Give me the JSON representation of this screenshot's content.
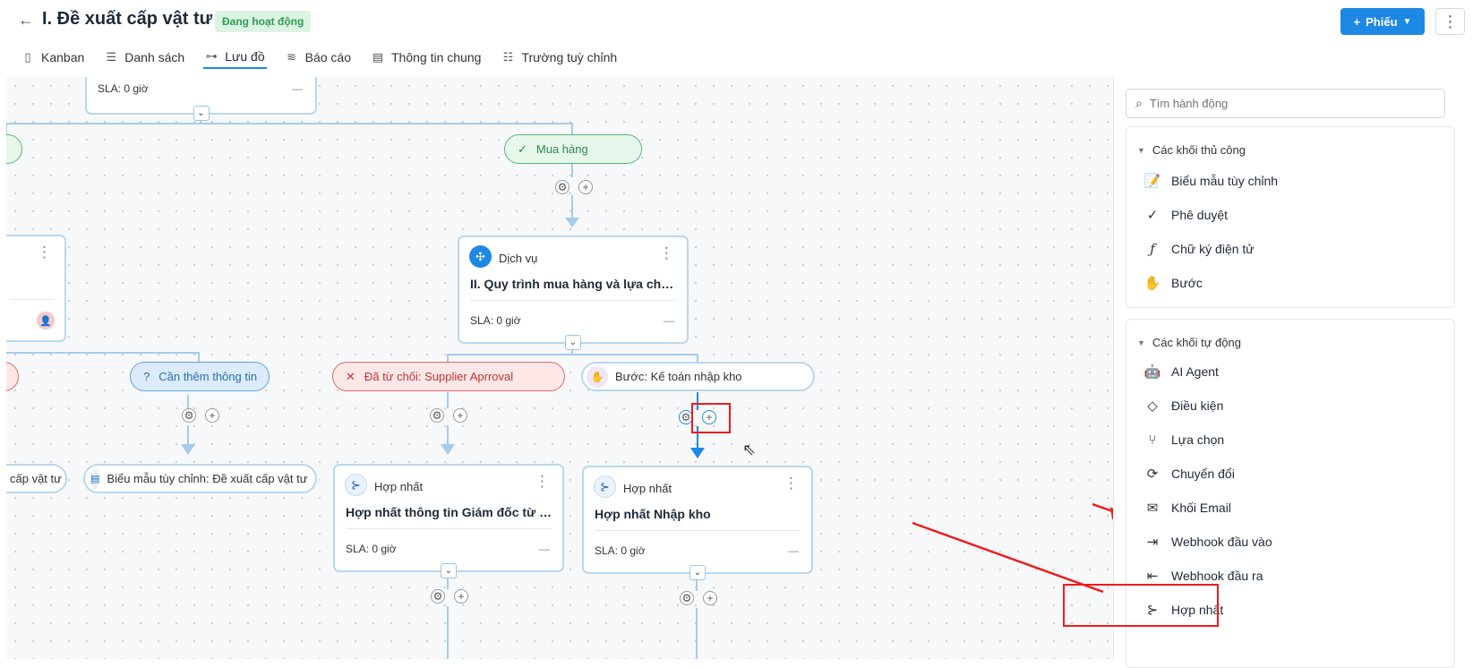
{
  "header": {
    "back_icon": "arrow-left-icon",
    "title": "I. Đề xuất cấp vật tư",
    "status": "Đang hoạt động",
    "ticket_button": "Phiếu",
    "more_icon": "kebab-vertical-icon"
  },
  "tabs": [
    {
      "label": "Kanban",
      "icon": "kanban-icon"
    },
    {
      "label": "Danh sách",
      "icon": "list-icon"
    },
    {
      "label": "Lưu đồ",
      "icon": "flowchart-icon",
      "active": true
    },
    {
      "label": "Báo cáo",
      "icon": "report-icon"
    },
    {
      "label": "Thông tin chung",
      "icon": "info-icon"
    },
    {
      "label": "Trường tuỳ chỉnh",
      "icon": "custom-fields-icon"
    }
  ],
  "flow": {
    "top_node": {
      "sla_label": "SLA:",
      "sla_value": "0 giờ",
      "dash": "—"
    },
    "pill_mua_hang": "Mua hàng",
    "dich_vu_node": {
      "type": "Dịch vụ",
      "name": "II. Quy trình mua hàng và lựa chọn ...",
      "sla_label": "SLA:",
      "sla_value": "0 giờ",
      "dash": "—"
    },
    "pill_can_them": "Cần thêm thông tin",
    "pill_da_tu_choi": "Đã từ chối: Supplier Aprroval",
    "pill_buoc": "Bước: Kế toán nhập kho",
    "left_partial_pill": "cấp vật tư",
    "pill_bieu_mau": "Biểu mẫu tùy chỉnh: Đề xuất cấp vật tư",
    "hop_nhat_1": {
      "type": "Hợp nhất",
      "name": "Hợp nhất thông tin Giám đốc từ ch...",
      "sla_label": "SLA:",
      "sla_value": "0 giờ",
      "dash": "—"
    },
    "hop_nhat_2": {
      "type": "Hợp nhất",
      "name": "Hợp nhất Nhập kho",
      "sla_label": "SLA:",
      "sla_value": "0 giờ",
      "dash": "—"
    }
  },
  "sidebar": {
    "search_placeholder": "Tìm hành động",
    "manual_group": {
      "title": "Các khối thủ công",
      "items": [
        {
          "label": "Biểu mẫu tùy chỉnh",
          "icon": "form-icon"
        },
        {
          "label": "Phê duyệt",
          "icon": "check-circle-icon"
        },
        {
          "label": "Chữ ký điện tử",
          "icon": "signature-icon"
        },
        {
          "label": "Bước",
          "icon": "step-icon"
        }
      ]
    },
    "auto_group": {
      "title": "Các khối tự động",
      "items": [
        {
          "label": "AI Agent",
          "icon": "robot-icon"
        },
        {
          "label": "Điều kiện",
          "icon": "condition-icon"
        },
        {
          "label": "Lựa chọn",
          "icon": "branch-icon"
        },
        {
          "label": "Chuyển đổi",
          "icon": "convert-icon"
        },
        {
          "label": "Khối Email",
          "icon": "email-icon"
        },
        {
          "label": "Webhook đầu vào",
          "icon": "webhook-in-icon"
        },
        {
          "label": "Webhook đầu ra",
          "icon": "webhook-out-icon"
        },
        {
          "label": "Hợp nhất",
          "icon": "merge-icon"
        }
      ]
    }
  },
  "colors": {
    "primary": "#1e88e5",
    "highlight": "#ee1c1c",
    "connector": "#a7cbe8"
  }
}
